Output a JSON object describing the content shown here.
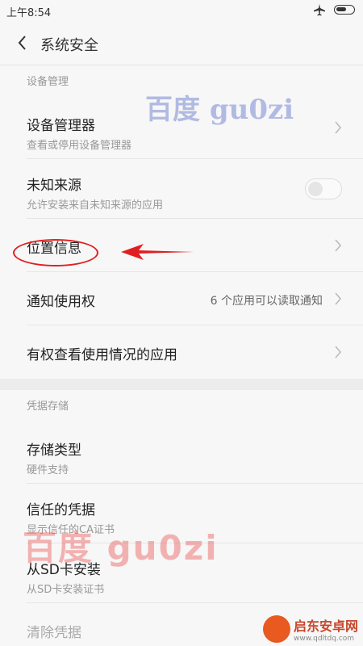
{
  "status_bar": {
    "time": "上午8:54",
    "airplane_icon": "airplane-icon",
    "battery_icon": "battery-icon"
  },
  "app_bar": {
    "title": "系统安全",
    "back_icon": "back-arrow-icon"
  },
  "sections": {
    "device_mgmt": {
      "header": "设备管理",
      "items": {
        "device_admin": {
          "title": "设备管理器",
          "subtitle": "查看或停用设备管理器"
        },
        "unknown_sources": {
          "title": "未知来源",
          "subtitle": "允许安装来自未知来源的应用",
          "toggle_on": false
        },
        "location": {
          "title": "位置信息"
        },
        "notification_access": {
          "title": "通知使用权",
          "value": "6 个应用可以读取通知"
        },
        "usage_access": {
          "title": "有权查看使用情况的应用"
        }
      }
    },
    "credential_storage": {
      "header": "凭据存储",
      "items": {
        "storage_type": {
          "title": "存储类型",
          "subtitle": "硬件支持"
        },
        "trusted_credentials": {
          "title": "信任的凭据",
          "subtitle": "显示信任的CA证书"
        },
        "install_from_sd": {
          "title": "从SD卡安装",
          "subtitle": "从SD卡安装证书"
        },
        "clear_credentials": {
          "title": "清除凭据"
        }
      }
    }
  },
  "watermarks": {
    "top": "百度 gu0zi",
    "bottom": "百度 gu0zi"
  },
  "corner_logo": {
    "name": "启东安卓网",
    "url": "www.qdltdq.com"
  },
  "colors": {
    "annotation_red": "#e02020"
  }
}
